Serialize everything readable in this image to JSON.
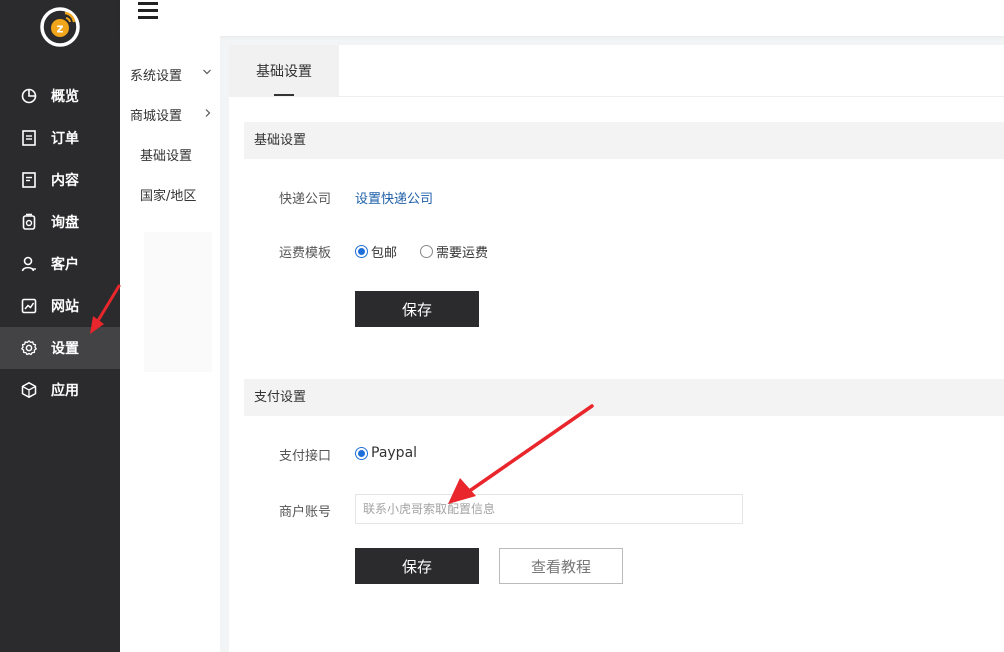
{
  "nav": {
    "items": [
      {
        "label": "概览",
        "icon": "pie-chart-icon"
      },
      {
        "label": "订单",
        "icon": "order-list-icon"
      },
      {
        "label": "内容",
        "icon": "content-doc-icon"
      },
      {
        "label": "询盘",
        "icon": "inquiry-icon"
      },
      {
        "label": "客户",
        "icon": "customer-icon"
      },
      {
        "label": "网站",
        "icon": "website-chart-icon"
      },
      {
        "label": "设置",
        "icon": "gear-icon"
      },
      {
        "label": "应用",
        "icon": "app-cube-icon"
      }
    ],
    "active_index": 6
  },
  "submenu": {
    "system_settings": "系统设置",
    "mall_settings": "商城设置",
    "basic_settings": "基础设置",
    "country_region": "国家/地区"
  },
  "tabs": [
    {
      "label": "基础设置"
    }
  ],
  "basic_section": {
    "title": "基础设置",
    "express_label": "快递公司",
    "express_link": "设置快递公司",
    "shipping_label": "运费模板",
    "shipping_options": [
      "包邮",
      "需要运费"
    ],
    "shipping_selected": "包邮",
    "save_label": "保存"
  },
  "payment_section": {
    "title": "支付设置",
    "gateway_label": "支付接口",
    "gateway_option": "Paypal",
    "merchant_label": "商户账号",
    "merchant_placeholder": "联系小虎哥索取配置信息",
    "merchant_value": "",
    "save_label": "保存",
    "tutorial_label": "查看教程"
  },
  "colors": {
    "nav_bg": "#2b2b2d",
    "nav_active": "#434346",
    "link": "#1e5fa8",
    "radio_on": "#1e6fd9",
    "annotation_arrow": "#e8262b"
  }
}
